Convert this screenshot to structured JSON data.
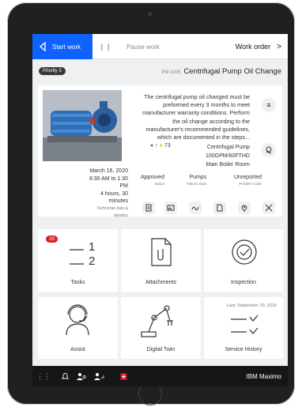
{
  "topbar": {
    "start_label": "Start work",
    "pause_label": "Pause work",
    "title": "Work order"
  },
  "workorder": {
    "priority": "Priority 3",
    "title": "Centrifugal Pump Oil Change",
    "pm": "PM 1006",
    "description": "The centrifugal pump oil changed must be preformed every 3 months to meet manufacturer warranty conditions. Perform the oil change according to the manufacturer's recommended guidelines, which are documented in the steps...",
    "asset_name": "Centrifugal Pump 100GPM/60FTHD",
    "asset_count": "73",
    "location": "Main Boiler Room",
    "date": "March 16, 2020",
    "time": "8:30 AM to 1:30 PM",
    "duration": "4 hours, 30 minutes",
    "duration_caption": "Technician date & duration"
  },
  "statuses": [
    {
      "value": "Approved",
      "caption": "Status"
    },
    {
      "value": "Pumps",
      "caption": "Failure class"
    },
    {
      "value": "Unreported",
      "caption": "Problem Code"
    }
  ],
  "tiles": {
    "tasks_label": "Tasks",
    "tasks_badge": "20",
    "tasks_1": "1",
    "tasks_2": "2",
    "attachments_label": "Attachments",
    "inspection_label": "Inspection",
    "assist_label": "Assist",
    "digital_twin_label": "Digital Twin",
    "service_history_label": "Service History",
    "service_history_date": "Last: September 20, 2019"
  },
  "bottombar": {
    "brand": "IBM Maximo"
  },
  "colors": {
    "accent": "#0f62fe",
    "badge": "#da1e28",
    "bottombar": "#161616",
    "dot_green": "#24a148",
    "dot_yellow": "#f1c21b"
  }
}
